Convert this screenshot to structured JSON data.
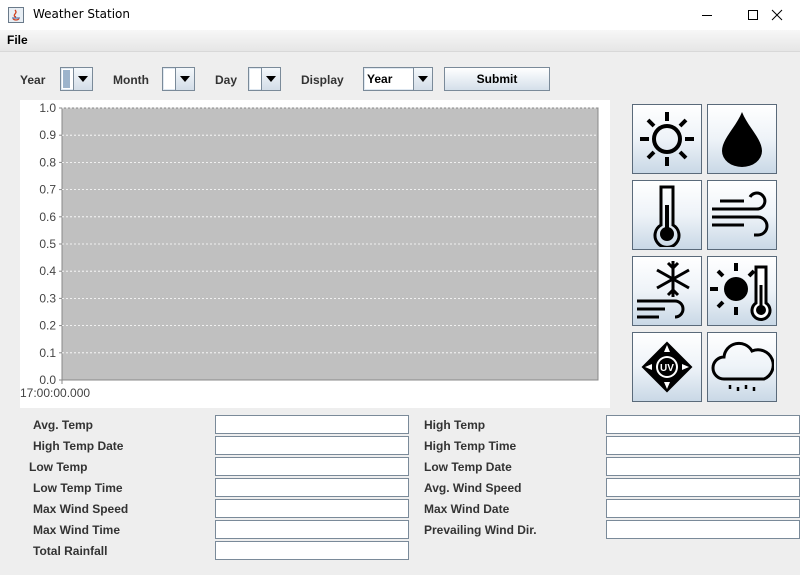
{
  "window": {
    "title": "Weather Station"
  },
  "menu": {
    "file": "File"
  },
  "controls": {
    "year_label": "Year",
    "month_label": "Month",
    "day_label": "Day",
    "display_label": "Display",
    "display_value": "Year",
    "submit_label": "Submit"
  },
  "chart_data": {
    "type": "line",
    "ylim": [
      0.0,
      1.0
    ],
    "y_ticks": [
      "0.0",
      "0.1",
      "0.2",
      "0.3",
      "0.4",
      "0.5",
      "0.6",
      "0.7",
      "0.8",
      "0.9",
      "1.0"
    ],
    "x_ticks": [
      "17:00:00.000"
    ],
    "series": [],
    "grid": true,
    "plot_background": "#c0c0c0"
  },
  "icons": [
    "sun-icon",
    "water-drop-icon",
    "thermometer-icon",
    "wind-icon",
    "wind-chill-icon",
    "heat-index-icon",
    "uv-index-icon",
    "rain-cloud-icon"
  ],
  "stats": {
    "left": [
      "Avg. Temp",
      "High Temp Date",
      "Low Temp",
      "Low Temp Time",
      "Max Wind Speed",
      "Max Wind Time",
      "Total Rainfall"
    ],
    "right": [
      "High Temp",
      "High Temp Time",
      "Low Temp Date",
      "Avg. Wind Speed",
      "Max Wind Date",
      "Prevailing Wind Dir."
    ]
  }
}
